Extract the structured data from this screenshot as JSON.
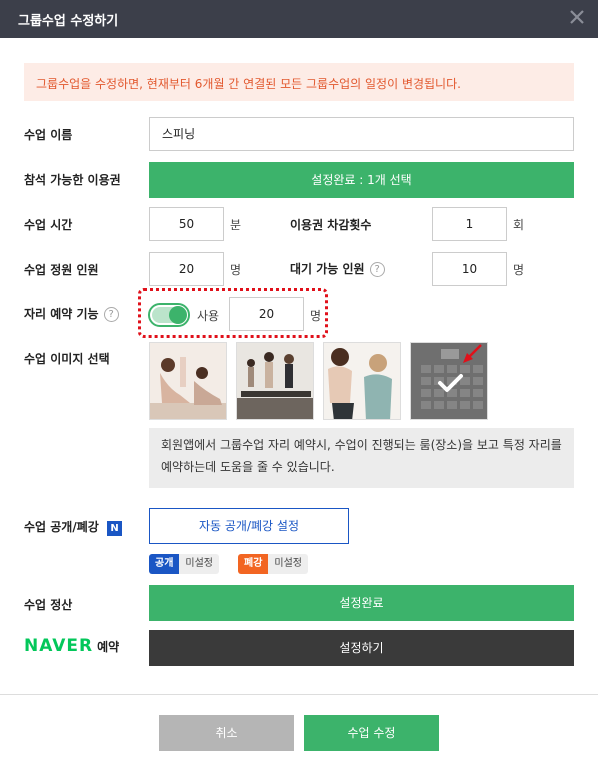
{
  "header": {
    "title": "그룹수업 수정하기",
    "close_icon": "close-icon"
  },
  "notice": "그룹수업을 수정하면, 현재부터 6개월 간 연결된 모든 그룹수업의 일정이 변경됩니다.",
  "class_name": {
    "label": "수업 이름",
    "value": "스피닝"
  },
  "pass": {
    "label": "참석 가능한 이용권",
    "button": "설정완료 : 1개 선택"
  },
  "class_time": {
    "label": "수업 시간",
    "value": "50",
    "unit": "분"
  },
  "deduction": {
    "label": "이용권 차감횟수",
    "value": "1",
    "unit": "회"
  },
  "capacity": {
    "label": "수업 정원 인원",
    "value": "20",
    "unit": "명"
  },
  "waitlist": {
    "label": "대기 가능 인원",
    "help": "?",
    "value": "10",
    "unit": "명"
  },
  "seat": {
    "label": "자리 예약 기능",
    "help": "?",
    "toggle_label": "사용",
    "toggle_on": true,
    "value": "20",
    "unit": "명"
  },
  "image": {
    "label": "수업 이미지 선택",
    "selected_index": 3
  },
  "info_text": "회원앱에서 그룹수업 자리 예약시, 수업이 진행되는 룸(장소)을 보고 특정 자리를 예약하는데 도움을 줄 수 있습니다.",
  "publish": {
    "label": "수업 공개/폐강",
    "new_badge": "N",
    "button": "자동 공개/폐강 설정",
    "open_tag": "공개",
    "open_value": "미설정",
    "close_tag": "폐강",
    "close_value": "미설정"
  },
  "settlement": {
    "label": "수업 정산",
    "button": "설정완료"
  },
  "naver": {
    "logo": "NAVER",
    "sub": "예약",
    "button": "설정하기"
  },
  "footer": {
    "cancel": "취소",
    "submit": "수업 수정"
  },
  "colors": {
    "green": "#3cb36b",
    "header": "#3c3f4a",
    "notice_bg": "#fdece6",
    "notice_text": "#e2582e",
    "blue": "#1a56c4",
    "orange": "#f26522"
  }
}
